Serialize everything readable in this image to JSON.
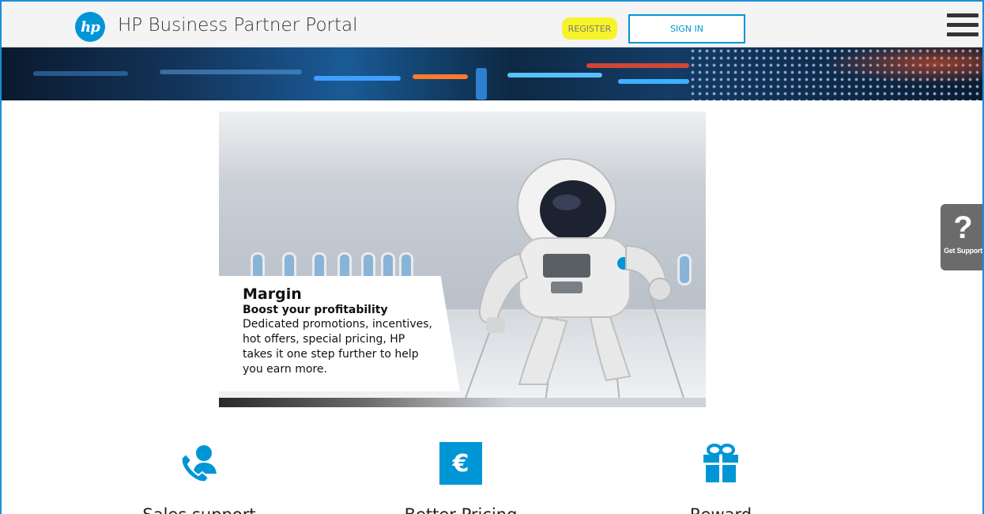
{
  "header": {
    "logo_text": "hp",
    "title": "HP Business Partner Portal",
    "register_label": "REGISTER",
    "signin_label": "SIGN IN"
  },
  "hero": {
    "title": "Margin",
    "subtitle": "Boost your profitability",
    "body": "Dedicated promotions, incentives, hot offers, special pricing, HP takes it one step further to help you earn more."
  },
  "support": {
    "glyph": "?",
    "label": "Get Support"
  },
  "features": [
    {
      "label": "Sales support",
      "icon": "phone-person-icon"
    },
    {
      "label": "Better Pricing",
      "icon": "euro-icon",
      "glyph": "€"
    },
    {
      "label": "Reward",
      "icon": "gift-icon"
    }
  ],
  "colors": {
    "brand_blue": "#0096d6",
    "highlight_yellow": "#f7f329",
    "support_gray": "#6b6b6b"
  }
}
